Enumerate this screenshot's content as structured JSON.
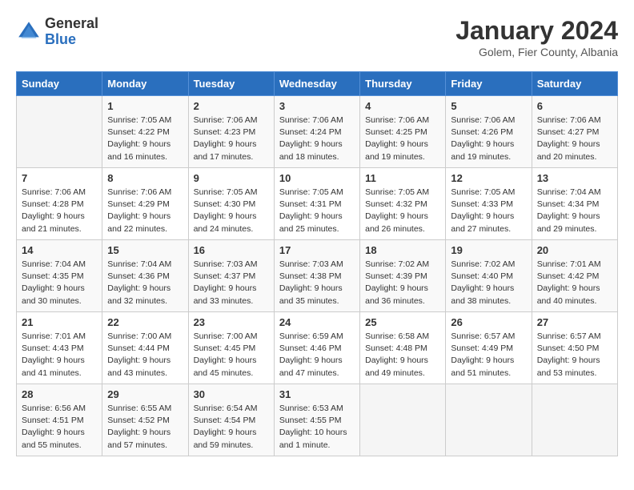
{
  "logo": {
    "general": "General",
    "blue": "Blue"
  },
  "header": {
    "title": "January 2024",
    "subtitle": "Golem, Fier County, Albania"
  },
  "weekdays": [
    "Sunday",
    "Monday",
    "Tuesday",
    "Wednesday",
    "Thursday",
    "Friday",
    "Saturday"
  ],
  "weeks": [
    [
      {
        "day": "",
        "sunrise": "",
        "sunset": "",
        "daylight": ""
      },
      {
        "day": "1",
        "sunrise": "Sunrise: 7:05 AM",
        "sunset": "Sunset: 4:22 PM",
        "daylight": "Daylight: 9 hours and 16 minutes."
      },
      {
        "day": "2",
        "sunrise": "Sunrise: 7:06 AM",
        "sunset": "Sunset: 4:23 PM",
        "daylight": "Daylight: 9 hours and 17 minutes."
      },
      {
        "day": "3",
        "sunrise": "Sunrise: 7:06 AM",
        "sunset": "Sunset: 4:24 PM",
        "daylight": "Daylight: 9 hours and 18 minutes."
      },
      {
        "day": "4",
        "sunrise": "Sunrise: 7:06 AM",
        "sunset": "Sunset: 4:25 PM",
        "daylight": "Daylight: 9 hours and 19 minutes."
      },
      {
        "day": "5",
        "sunrise": "Sunrise: 7:06 AM",
        "sunset": "Sunset: 4:26 PM",
        "daylight": "Daylight: 9 hours and 19 minutes."
      },
      {
        "day": "6",
        "sunrise": "Sunrise: 7:06 AM",
        "sunset": "Sunset: 4:27 PM",
        "daylight": "Daylight: 9 hours and 20 minutes."
      }
    ],
    [
      {
        "day": "7",
        "sunrise": "Sunrise: 7:06 AM",
        "sunset": "Sunset: 4:28 PM",
        "daylight": "Daylight: 9 hours and 21 minutes."
      },
      {
        "day": "8",
        "sunrise": "Sunrise: 7:06 AM",
        "sunset": "Sunset: 4:29 PM",
        "daylight": "Daylight: 9 hours and 22 minutes."
      },
      {
        "day": "9",
        "sunrise": "Sunrise: 7:05 AM",
        "sunset": "Sunset: 4:30 PM",
        "daylight": "Daylight: 9 hours and 24 minutes."
      },
      {
        "day": "10",
        "sunrise": "Sunrise: 7:05 AM",
        "sunset": "Sunset: 4:31 PM",
        "daylight": "Daylight: 9 hours and 25 minutes."
      },
      {
        "day": "11",
        "sunrise": "Sunrise: 7:05 AM",
        "sunset": "Sunset: 4:32 PM",
        "daylight": "Daylight: 9 hours and 26 minutes."
      },
      {
        "day": "12",
        "sunrise": "Sunrise: 7:05 AM",
        "sunset": "Sunset: 4:33 PM",
        "daylight": "Daylight: 9 hours and 27 minutes."
      },
      {
        "day": "13",
        "sunrise": "Sunrise: 7:04 AM",
        "sunset": "Sunset: 4:34 PM",
        "daylight": "Daylight: 9 hours and 29 minutes."
      }
    ],
    [
      {
        "day": "14",
        "sunrise": "Sunrise: 7:04 AM",
        "sunset": "Sunset: 4:35 PM",
        "daylight": "Daylight: 9 hours and 30 minutes."
      },
      {
        "day": "15",
        "sunrise": "Sunrise: 7:04 AM",
        "sunset": "Sunset: 4:36 PM",
        "daylight": "Daylight: 9 hours and 32 minutes."
      },
      {
        "day": "16",
        "sunrise": "Sunrise: 7:03 AM",
        "sunset": "Sunset: 4:37 PM",
        "daylight": "Daylight: 9 hours and 33 minutes."
      },
      {
        "day": "17",
        "sunrise": "Sunrise: 7:03 AM",
        "sunset": "Sunset: 4:38 PM",
        "daylight": "Daylight: 9 hours and 35 minutes."
      },
      {
        "day": "18",
        "sunrise": "Sunrise: 7:02 AM",
        "sunset": "Sunset: 4:39 PM",
        "daylight": "Daylight: 9 hours and 36 minutes."
      },
      {
        "day": "19",
        "sunrise": "Sunrise: 7:02 AM",
        "sunset": "Sunset: 4:40 PM",
        "daylight": "Daylight: 9 hours and 38 minutes."
      },
      {
        "day": "20",
        "sunrise": "Sunrise: 7:01 AM",
        "sunset": "Sunset: 4:42 PM",
        "daylight": "Daylight: 9 hours and 40 minutes."
      }
    ],
    [
      {
        "day": "21",
        "sunrise": "Sunrise: 7:01 AM",
        "sunset": "Sunset: 4:43 PM",
        "daylight": "Daylight: 9 hours and 41 minutes."
      },
      {
        "day": "22",
        "sunrise": "Sunrise: 7:00 AM",
        "sunset": "Sunset: 4:44 PM",
        "daylight": "Daylight: 9 hours and 43 minutes."
      },
      {
        "day": "23",
        "sunrise": "Sunrise: 7:00 AM",
        "sunset": "Sunset: 4:45 PM",
        "daylight": "Daylight: 9 hours and 45 minutes."
      },
      {
        "day": "24",
        "sunrise": "Sunrise: 6:59 AM",
        "sunset": "Sunset: 4:46 PM",
        "daylight": "Daylight: 9 hours and 47 minutes."
      },
      {
        "day": "25",
        "sunrise": "Sunrise: 6:58 AM",
        "sunset": "Sunset: 4:48 PM",
        "daylight": "Daylight: 9 hours and 49 minutes."
      },
      {
        "day": "26",
        "sunrise": "Sunrise: 6:57 AM",
        "sunset": "Sunset: 4:49 PM",
        "daylight": "Daylight: 9 hours and 51 minutes."
      },
      {
        "day": "27",
        "sunrise": "Sunrise: 6:57 AM",
        "sunset": "Sunset: 4:50 PM",
        "daylight": "Daylight: 9 hours and 53 minutes."
      }
    ],
    [
      {
        "day": "28",
        "sunrise": "Sunrise: 6:56 AM",
        "sunset": "Sunset: 4:51 PM",
        "daylight": "Daylight: 9 hours and 55 minutes."
      },
      {
        "day": "29",
        "sunrise": "Sunrise: 6:55 AM",
        "sunset": "Sunset: 4:52 PM",
        "daylight": "Daylight: 9 hours and 57 minutes."
      },
      {
        "day": "30",
        "sunrise": "Sunrise: 6:54 AM",
        "sunset": "Sunset: 4:54 PM",
        "daylight": "Daylight: 9 hours and 59 minutes."
      },
      {
        "day": "31",
        "sunrise": "Sunrise: 6:53 AM",
        "sunset": "Sunset: 4:55 PM",
        "daylight": "Daylight: 10 hours and 1 minute."
      },
      {
        "day": "",
        "sunrise": "",
        "sunset": "",
        "daylight": ""
      },
      {
        "day": "",
        "sunrise": "",
        "sunset": "",
        "daylight": ""
      },
      {
        "day": "",
        "sunrise": "",
        "sunset": "",
        "daylight": ""
      }
    ]
  ]
}
